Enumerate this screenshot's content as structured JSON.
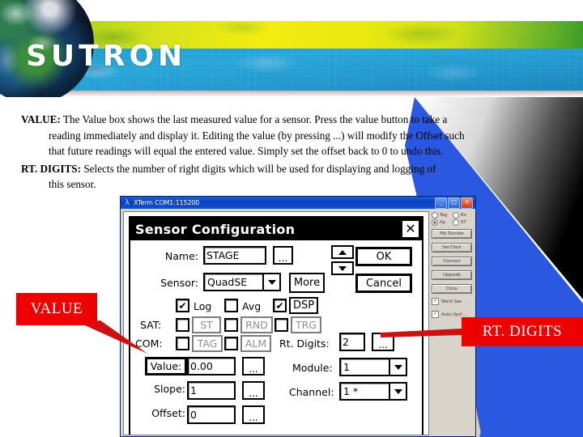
{
  "header": {
    "brand": "SUTRON",
    "colors": {
      "yellow": "#eae80f",
      "green": "#3f9a26",
      "blue": "#2aa6d8"
    }
  },
  "copy": {
    "value_lead": "VALUE:",
    "value_line1": " The Value box shows the last measured value for a sensor.  Press the value button to take a",
    "value_line2": "reading immediately and display it.  Editing the value (by pressing ...) will modify the Offset such",
    "value_line3": "that future readings will equal the entered value.  Simply set the offset back to 0 to undo this.",
    "rt_lead": "RT. DIGITS:",
    "rt_line1": " Selects the number of right digits which will be used for displaying and logging of",
    "rt_line2": "this sensor."
  },
  "xterm": {
    "title": "XTerm COM1:115200",
    "title_icon": "terminal-icon",
    "minimize_label": "_",
    "maximize_label": "□",
    "close_label": "✕",
    "radios": [
      {
        "label": "Tag",
        "selected": false
      },
      {
        "label": "Rx",
        "selected": false
      },
      {
        "label": "Xp",
        "selected": true
      },
      {
        "label": "ST",
        "selected": false
      }
    ],
    "buttons": [
      "File Transfer",
      "Set Clock",
      "Connect",
      "Upgrade",
      "Close"
    ],
    "checks": [
      {
        "label": "Word Sav",
        "checked": true
      },
      {
        "label": "Auto Upd ...",
        "checked": true
      }
    ]
  },
  "dialog": {
    "title": "Sensor Configuration",
    "close_label": "✕",
    "name_label": "Name:",
    "name_value": "STAGE",
    "name_dots": "...",
    "sensor_label": "Sensor:",
    "sensor_value": "QuadSE",
    "more_label": "More",
    "ok_label": "OK",
    "cancel_label": "Cancel",
    "spin_up": "▲",
    "spin_down": "▼",
    "check_log": {
      "label": "Log",
      "checked": true
    },
    "check_avg": {
      "label": "Avg",
      "checked": false
    },
    "check_dsp": {
      "label": "DSP",
      "checked": true
    },
    "sat_label": "SAT:",
    "sat_st": {
      "label": "ST",
      "checked": false
    },
    "sat_rnd": {
      "label": "RND",
      "checked": false
    },
    "sat_trg": {
      "label": "TRG",
      "checked": false
    },
    "com_label": "COM:",
    "com_tag": {
      "label": "TAG",
      "checked": false
    },
    "com_alm": {
      "label": "ALM",
      "checked": false
    },
    "rt_digits_label": "Rt. Digits:",
    "rt_digits_value": "2",
    "rt_digits_dots": "...",
    "value_label": "Value:",
    "value_value": "0.00",
    "value_dots": "...",
    "slope_label": "Slope:",
    "slope_value": "1",
    "slope_dots": "...",
    "offset_label": "Offset:",
    "offset_value": "0",
    "offset_dots": "...",
    "module_label": "Module:",
    "module_value": "1",
    "channel_label": "Channel:",
    "channel_value": "1 *"
  },
  "callouts": {
    "value": "VALUE",
    "rt_digits": "RT. DIGITS",
    "color": "#ee0000"
  }
}
